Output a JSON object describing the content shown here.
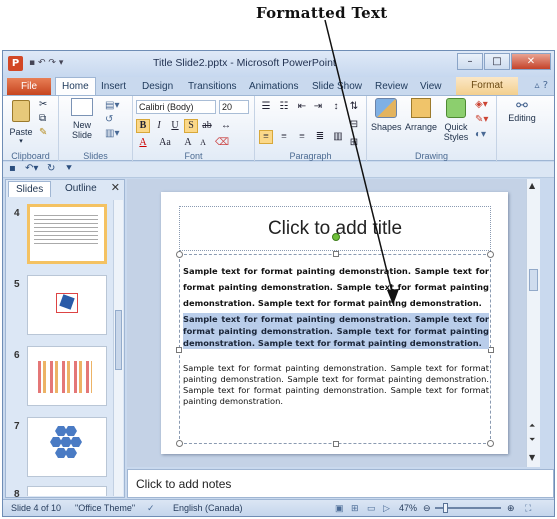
{
  "caption": "Formatted Text",
  "window": {
    "title": "Title Slide2.pptx - Microsoft PowerPoint",
    "app_icon": "P",
    "buttons": [
      "–",
      "□",
      "✕"
    ]
  },
  "tabs": {
    "file": "File",
    "items": [
      "Home",
      "Insert",
      "Design",
      "Transitions",
      "Animations",
      "Slide Show",
      "Review",
      "View"
    ],
    "contextual": "Format"
  },
  "ribbon": {
    "clipboard": {
      "label": "Clipboard",
      "paste": "Paste"
    },
    "slides": {
      "label": "Slides",
      "new_slide": "New Slide"
    },
    "font": {
      "label": "Font",
      "font_name": "Calibri (Body)",
      "font_size": "20"
    },
    "paragraph": {
      "label": "Paragraph"
    },
    "drawing": {
      "label": "Drawing",
      "shapes": "Shapes",
      "arrange": "Arrange",
      "quick_styles": "Quick Styles"
    },
    "editing": {
      "label": "Editing"
    }
  },
  "panel": {
    "tab_slides": "Slides",
    "tab_outline": "Outline",
    "slide_numbers": [
      "4",
      "5",
      "6",
      "7",
      "8"
    ]
  },
  "slide": {
    "title_placeholder": "Click to add title",
    "para1": "Sample text for format painting demonstration. Sample text for format painting demonstration. Sample text for format painting demonstration. Sample text for format painting demonstration.",
    "para2": "Sample text for format painting demonstration. Sample text for format painting demonstration. Sample text for format painting demonstration. Sample text for format painting demonstration.",
    "para3": "Sample text for format painting demonstration. Sample text for format painting demonstration. Sample text for format painting demonstration. Sample text for format painting demonstration. Sample text for format painting demonstration."
  },
  "notes_placeholder": "Click to add notes",
  "status": {
    "slide_info": "Slide 4 of 10",
    "theme": "\"Office Theme\"",
    "language": "English (Canada)",
    "zoom": "47%"
  }
}
